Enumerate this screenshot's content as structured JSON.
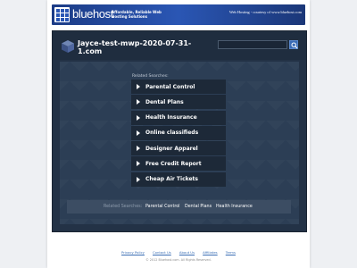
{
  "banner": {
    "brand": "bluehost",
    "tagline": "Affordable, Reliable Web Hosting Solutions",
    "courtesy": "Web Hosting - courtesy of www.bluehost.com"
  },
  "header": {
    "domain_title": "Jayce-test-mwp-2020-07-31-1.com",
    "search_placeholder": "",
    "search_icon": "search-icon"
  },
  "related": {
    "label": "Related Searches:",
    "items": [
      "Parental Control",
      "Dental Plans",
      "Health Insurance",
      "Online classifieds",
      "Designer Apparel",
      "Free Credit Report",
      "Cheap Air Tickets"
    ]
  },
  "bottom": {
    "label": "Related Searches:",
    "links": [
      "Parental Control",
      "Dental Plans",
      "Health Insurance"
    ]
  },
  "footer": {
    "links": [
      "Privacy Policy",
      "Contact Us",
      "About Us",
      "Affiliates",
      "Terms"
    ],
    "copyright": "© 2012 Bluehost.com. All Rights Reserved."
  },
  "colors": {
    "banner": "#2a56b4",
    "panel": "#233246",
    "link_bg": "#1d2938",
    "accent_button": "#3a6bb6"
  }
}
